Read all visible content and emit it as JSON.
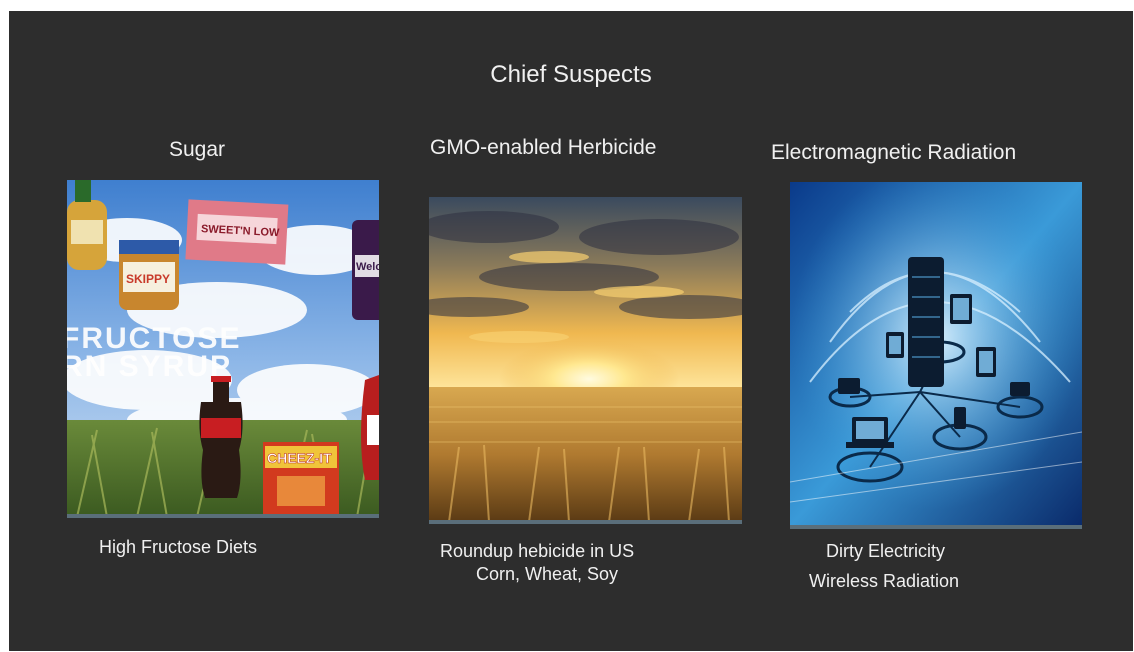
{
  "slide": {
    "title": "Chief Suspects",
    "columns": [
      {
        "heading": "Sugar",
        "image_label": "sugar-foods-image",
        "image_text": [
          "FRUCTOSE",
          "RN SYRUP",
          "CHEEZ-IT",
          "SKIPPY",
          "SWEET'N LOW",
          "Welch's"
        ],
        "captions": [
          "High Fructose Diets"
        ]
      },
      {
        "heading": "GMO-enabled Herbicide",
        "image_label": "wheat-field-sunset-image",
        "captions": [
          "Roundup hebicide in US",
          "Corn, Wheat, Soy"
        ]
      },
      {
        "heading": "Electromagnetic Radiation",
        "image_label": "wireless-network-image",
        "captions": [
          "Dirty Electricity",
          "Wireless Radiation"
        ]
      }
    ]
  },
  "colors": {
    "background": "#2d2d2d",
    "text": "#f0f0f0",
    "underline": "#5a6e7a"
  }
}
